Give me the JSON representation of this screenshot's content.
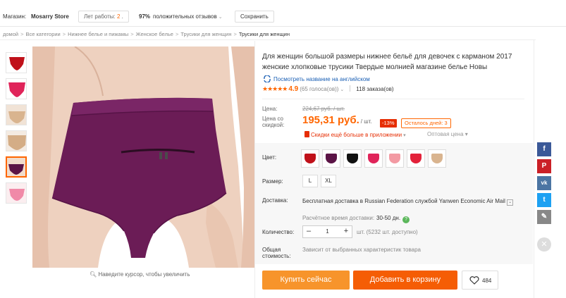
{
  "store": {
    "label": "Магазин:",
    "name": "Mosarry Store",
    "years_label": "Лет работы: ",
    "years_value": "2",
    "years_suffix": " .",
    "reviews_percent": "97%",
    "reviews_text": "положительных отзывов",
    "save_label": "Сохранить"
  },
  "breadcrumb": [
    "домой",
    "Все категории",
    "Нижнее белье и пижамы",
    "Женское белье",
    "Трусики для женщин",
    "Трусики для женщин"
  ],
  "product": {
    "title": "Для женщин большой размеры нижнее бельё для девочек с карманом 2017 женские хлопковые трусики Твердые молнией магазине белье Новы",
    "translate_link": "Посмотреть название на английском",
    "stars": "★★★★★",
    "rating": "4.9",
    "votes": "(65 голоса(ов))",
    "orders": "118 заказа(ов)"
  },
  "price": {
    "label": "Цена:",
    "old": "224,67 руб. / шт.",
    "discount_label": "Цена со скидкой:",
    "new": "195,31 руб.",
    "unit": "/ шт.",
    "discount_badge": "-13%",
    "days_left": "Осталось дней: 3",
    "app_promo": "Скидки ещё больше в приложении",
    "wholesale": "Оптовая цена"
  },
  "options": {
    "color_label": "Цвет:",
    "colors": [
      "#c0111a",
      "#5b1446",
      "#111111",
      "#e0245a",
      "#f39aa3",
      "#e3213a",
      "#d9b48f"
    ],
    "size_label": "Размер:",
    "sizes": [
      "L",
      "XL"
    ],
    "delivery_label": "Доставка:",
    "delivery_text": "Бесплатная доставка в Russian Federation службой Yanwen Economic Air Mail",
    "delivery_time_label": "Расчётное время доставки:",
    "delivery_time_value": "30-50 дн.",
    "qty_label": "Количество:",
    "qty_value": "1",
    "qty_minus": "–",
    "qty_plus": "+",
    "stock": "шт. (5232 шт. доступно)",
    "total_label": "Общая стоимость:",
    "total_value": "Зависит от выбранных характеристик товара"
  },
  "actions": {
    "buy": "Купить сейчас",
    "cart": "Добавить в корзину",
    "wishlist_count": "484"
  },
  "gallery": {
    "zoom_hint": "Наведите курсор, чтобы увеличить"
  },
  "social": [
    "f",
    "P",
    "vk",
    "t"
  ]
}
